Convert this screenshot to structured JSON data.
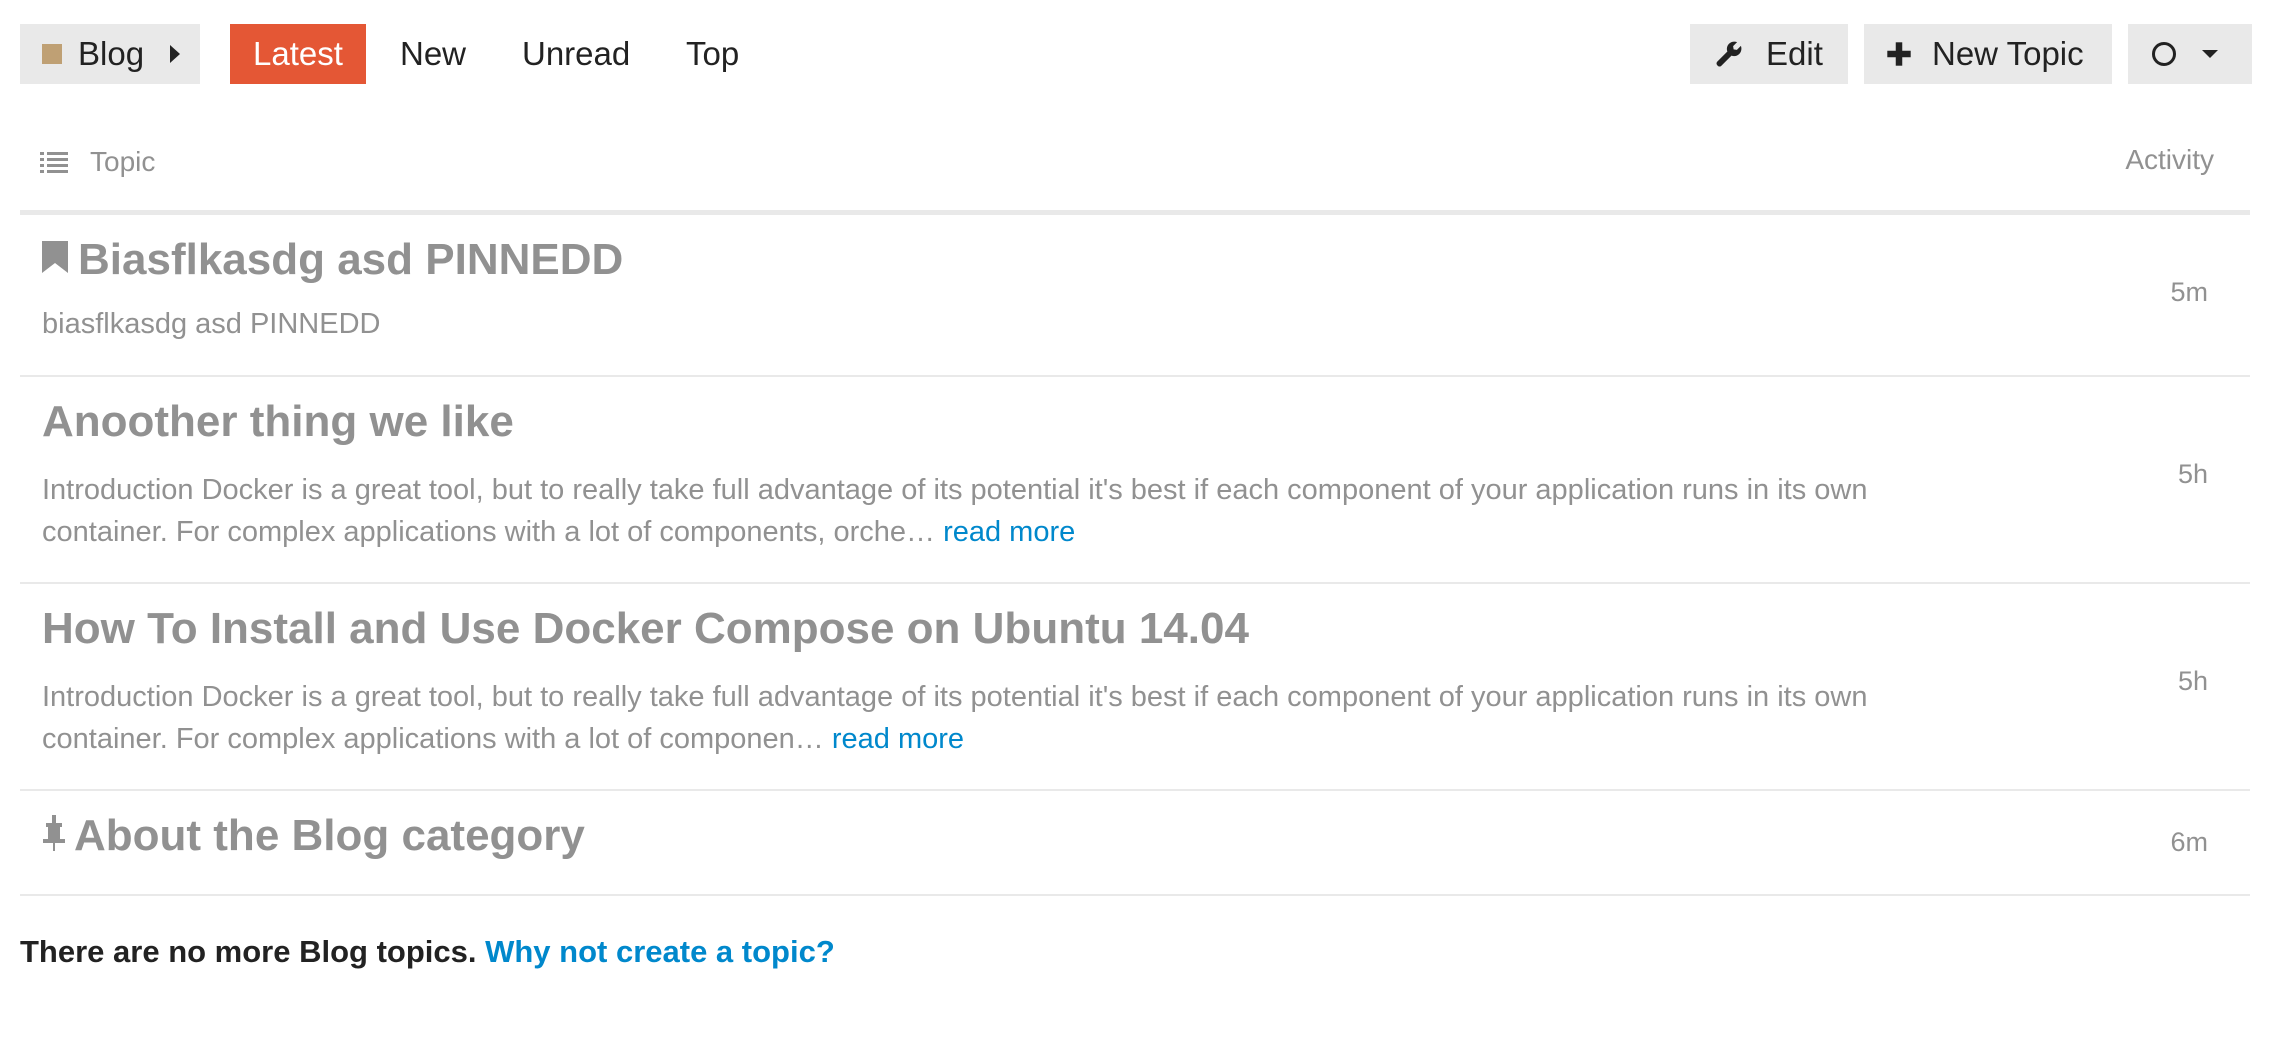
{
  "nav": {
    "category": {
      "label": "Blog",
      "color": "#BFA074",
      "icon": "caret-right-icon"
    },
    "tabs": [
      {
        "label": "Latest",
        "active": true
      },
      {
        "label": "New"
      },
      {
        "label": "Unread"
      },
      {
        "label": "Top"
      }
    ],
    "active_color": "#E45735",
    "edit": {
      "label": "Edit",
      "icon": "wrench-icon"
    },
    "new_topic": {
      "label": "New Topic",
      "icon": "plus-icon"
    },
    "notification": {
      "icon": "circle-icon",
      "dropdown_icon": "caret-down-icon"
    }
  },
  "table": {
    "header": {
      "topic": "Topic",
      "activity": "Activity",
      "icon": "list-icon"
    },
    "rows": [
      {
        "title": "Biasflkasdg asd PINNEDD",
        "excerpt": "biasflkasdg asd PINNEDD",
        "read_more": "",
        "activity": "5m",
        "icon": "bookmark-icon"
      },
      {
        "title": "Anoother thing we like",
        "excerpt": "Introduction Docker is a great tool, but to really take full advantage of its potential it's best if each component of your application runs in its own container. For complex applications with a lot of components, orche…",
        "read_more": "read more",
        "activity": "5h",
        "icon": ""
      },
      {
        "title": "How To Install and Use Docker Compose on Ubuntu 14.04",
        "excerpt": "Introduction Docker is a great tool, but to really take full advantage of its potential it's best if each component of your application runs in its own container. For complex applications with a lot of componen…",
        "read_more": "read more",
        "activity": "5h",
        "icon": ""
      },
      {
        "title": "About the Blog category",
        "excerpt": "",
        "read_more": "",
        "activity": "6m",
        "icon": "pin-icon"
      }
    ]
  },
  "footer": {
    "text": "There are no more Blog topics.",
    "link": "Why not create a topic?"
  },
  "colors": {
    "link": "#0088CC",
    "muted": "#919191",
    "button_bg": "#E9E9E9"
  }
}
